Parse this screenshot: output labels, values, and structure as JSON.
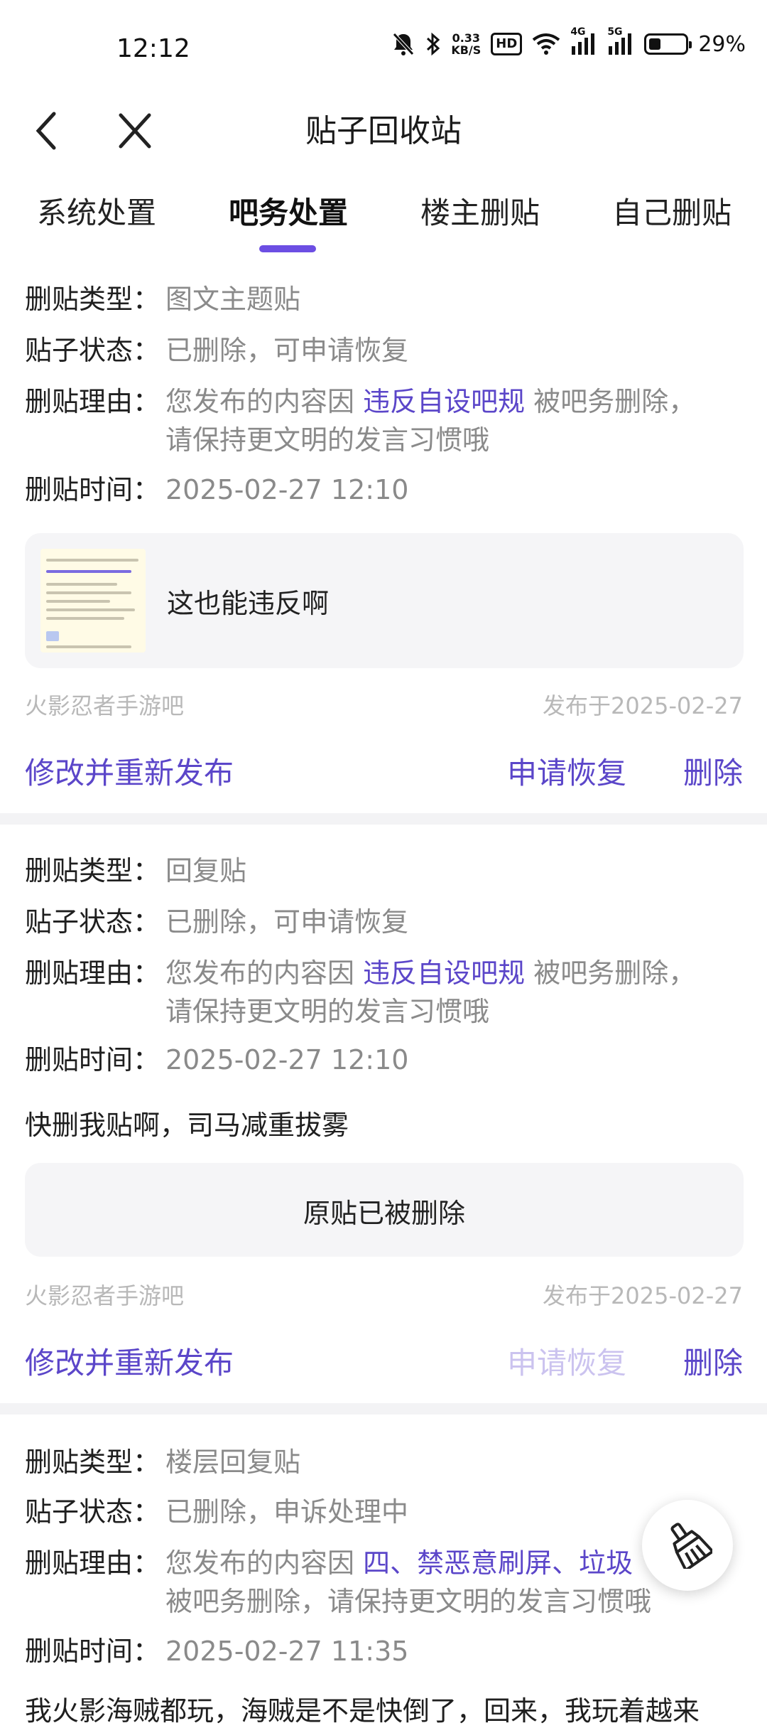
{
  "status": {
    "time": "12:12",
    "net_speed_top": "0.33",
    "net_speed_bottom": "KB/S",
    "hd": "HD",
    "sig1": "4G",
    "sig2": "5G",
    "battery": "29%"
  },
  "nav": {
    "title": "贴子回收站"
  },
  "tabs": [
    "系统处置",
    "吧务处置",
    "楼主删贴",
    "自己删贴"
  ],
  "labels": {
    "type": "删贴类型：",
    "status": "贴子状态：",
    "reason": "删贴理由：",
    "time": "删贴时间："
  },
  "posts": [
    {
      "type": "图文主题贴",
      "status": "已删除，可申请恢复",
      "reason_prefix": "您发布的内容因 ",
      "reason_link": "违反自设吧规",
      "reason_suffix": " 被吧务删除，",
      "reason_line2": "请保持更文明的发言习惯哦",
      "time": "2025-02-27 12:10",
      "quote_text": "这也能违反啊",
      "forum": "火影忍者手游吧",
      "published": "发布于2025-02-27",
      "action_edit": "修改并重新发布",
      "action_restore": "申请恢复",
      "action_delete": "删除"
    },
    {
      "type": "回复贴",
      "status": "已删除，可申请恢复",
      "reason_prefix": "您发布的内容因 ",
      "reason_link": "违反自设吧规",
      "reason_suffix": " 被吧务删除，",
      "reason_line2": "请保持更文明的发言习惯哦",
      "time": "2025-02-27 12:10",
      "content": "快删我贴啊，司马减重拔雾",
      "quote_text": "原贴已被删除",
      "forum": "火影忍者手游吧",
      "published": "发布于2025-02-27",
      "action_edit": "修改并重新发布",
      "action_restore": "申请恢复",
      "action_delete": "删除"
    },
    {
      "type": "楼层回复贴",
      "status": "已删除，申诉处理中",
      "reason_prefix": "您发布的内容因 ",
      "reason_link": "四、禁恶意刷屏、垃圾",
      "reason_line2": "被吧务删除，请保持更文明的发言习惯哦",
      "time": "2025-02-27 11:35",
      "content": "我火影海贼都玩，海贼是不是快倒了，回来，我玩着越来"
    }
  ]
}
